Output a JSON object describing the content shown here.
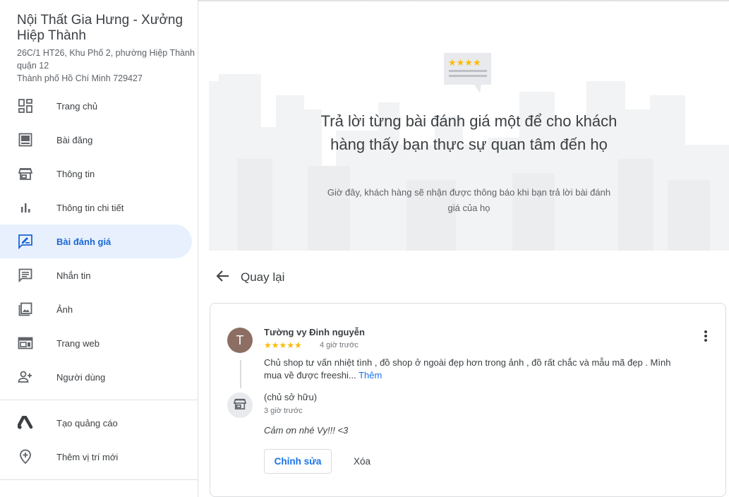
{
  "business": {
    "name": "Nội Thất Gia Hưng - Xưởng Hiệp Thành",
    "address_line1": "26C/1 HT26, Khu Phố 2, phường Hiệp Thành quận 12",
    "address_line2": "Thành phố Hồ Chí Minh 729427"
  },
  "sidebar": {
    "items": [
      {
        "label": "Trang chủ",
        "icon": "dashboard-icon"
      },
      {
        "label": "Bài đăng",
        "icon": "posts-icon"
      },
      {
        "label": "Thông tin",
        "icon": "storefront-icon"
      },
      {
        "label": "Thông tin chi tiết",
        "icon": "insights-icon"
      },
      {
        "label": "Bài đánh giá",
        "icon": "reviews-icon",
        "active": true
      },
      {
        "label": "Nhắn tin",
        "icon": "message-icon"
      },
      {
        "label": "Ảnh",
        "icon": "photo-icon"
      },
      {
        "label": "Trang web",
        "icon": "website-icon"
      },
      {
        "label": "Người dùng",
        "icon": "add-user-icon"
      }
    ],
    "extra_items": [
      {
        "label": "Tạo quảng cáo",
        "icon": "google-ads-icon"
      },
      {
        "label": "Thêm vị trí mới",
        "icon": "add-location-icon"
      }
    ]
  },
  "hero": {
    "title": "Trả lời từng bài đánh giá một để cho khách hàng thấy bạn thực sự quan tâm đến họ",
    "subtitle": "Giờ đây, khách hàng sẽ nhận được thông báo khi bạn trả lời bài đánh giá của họ"
  },
  "back": {
    "label": "Quay lại"
  },
  "review": {
    "avatar_letter": "T",
    "reviewer": "Tường vy Đinh nguyễn",
    "stars": "★★★★★",
    "rating": 5,
    "time": "4 giờ trước",
    "text": "Chủ shop tư vấn nhiệt tình , đồ shop ở ngoài đẹp hơn trong ảnh , đồ rất chắc và mẫu mã đẹp . Mình mua về được freeshi...",
    "more_label": "Thêm",
    "reply": {
      "owner_label": "(chủ sở hữu)",
      "time": "3 giờ trước",
      "text": "Cảm ơn nhé Vy!!! <3"
    },
    "edit_label": "Chỉnh sửa",
    "delete_label": "Xóa"
  },
  "colors": {
    "accent": "#1a73e8",
    "active_bg": "#e8f0fe",
    "star": "#fbbc04",
    "avatar": "#8d6e63"
  }
}
